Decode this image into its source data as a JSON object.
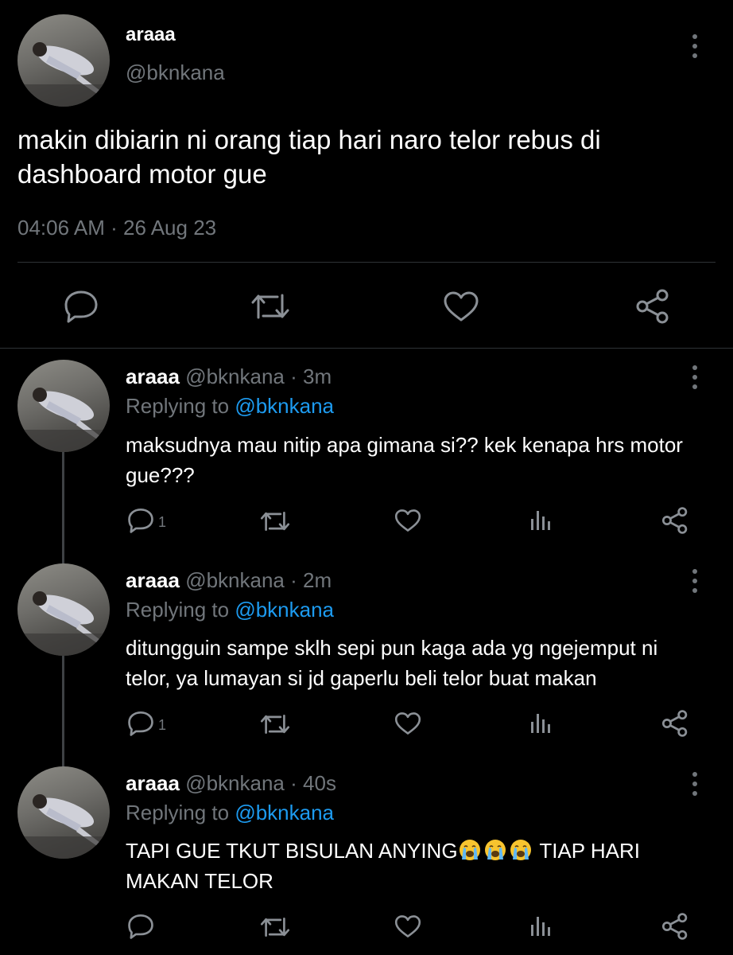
{
  "main_tweet": {
    "display_name": "araaa",
    "handle": "@bknkana",
    "text": "makin dibiarin ni orang tiap hari naro telor rebus di dashboard motor gue",
    "timestamp": "04:06 AM",
    "date_sep": "·",
    "date": "26 Aug 23",
    "actions": [
      "reply-icon",
      "retweet-icon",
      "like-icon",
      "share-icon"
    ]
  },
  "replies": [
    {
      "display_name": "araaa",
      "handle": "@bknkana",
      "sep": "·",
      "time": "3m",
      "replying_prefix": "Replying to",
      "replying_to": "@bknkana",
      "text": "maksudnya mau nitip apa gimana si?? kek kenapa hrs motor gue???",
      "reply_count": "1"
    },
    {
      "display_name": "araaa",
      "handle": "@bknkana",
      "sep": "·",
      "time": "2m",
      "replying_prefix": "Replying to",
      "replying_to": "@bknkana",
      "text": "ditungguin sampe sklh sepi pun kaga ada yg ngejemput ni telor, ya lumayan si jd gaperlu beli telor buat makan",
      "reply_count": "1"
    },
    {
      "display_name": "araaa",
      "handle": "@bknkana",
      "sep": "·",
      "time": "40s",
      "replying_prefix": "Replying to",
      "replying_to": "@bknkana",
      "text_before_emoji": "TAPI GUE TKUT BISULAN ANYING",
      "emoji": "loudly-crying-face-emoji",
      "emoji_count": 3,
      "text_after_emoji": " TIAP HARI MAKAN TELOR",
      "reply_count": ""
    }
  ],
  "colors": {
    "background": "#000000",
    "text": "#ffffff",
    "secondary": "#71767b",
    "link": "#1d9bf0",
    "divider": "#2f3336"
  }
}
